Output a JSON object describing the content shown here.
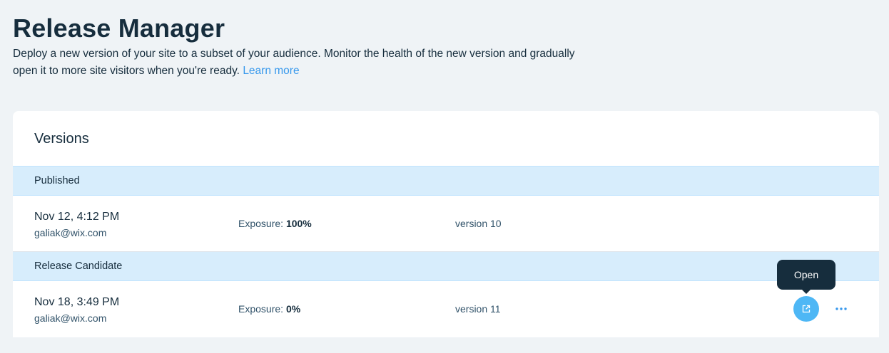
{
  "header": {
    "title": "Release Manager",
    "description": "Deploy a new version of your site to a subset of your audience. Monitor the health of the new version and gradually open it to more site visitors when you're ready.",
    "learn_more": "Learn more"
  },
  "versions": {
    "title": "Versions",
    "published": {
      "section_label": "Published",
      "date": "Nov 12, 4:12 PM",
      "email": "galiak@wix.com",
      "exposure_label": "Exposure:",
      "exposure_value": "100%",
      "version": "version 10"
    },
    "release_candidate": {
      "section_label": "Release Candidate",
      "date": "Nov 18, 3:49 PM",
      "email": "galiak@wix.com",
      "exposure_label": "Exposure:",
      "exposure_value": "0%",
      "version": "version 11",
      "open_tooltip": "Open",
      "open_icon": "external-link-icon",
      "more_icon": "more-horizontal-icon"
    }
  },
  "colors": {
    "page_background": "#eff3f6",
    "card_background": "#ffffff",
    "section_header_background": "#d7edfc",
    "accent": "#3899ec",
    "open_button": "#4eb7f5",
    "tooltip_background": "#162d3d",
    "text_primary": "#162d3d"
  }
}
